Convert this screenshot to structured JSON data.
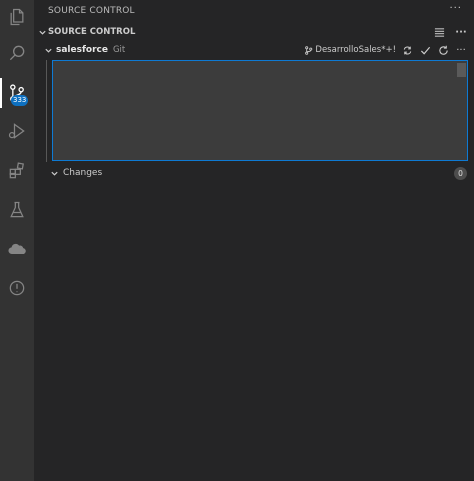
{
  "sidebar_title": "SOURCE CONTROL",
  "section": {
    "title": "SOURCE CONTROL"
  },
  "repository": {
    "name": "salesforce",
    "kind": "Git",
    "branch": "DesarrolloSales*+!"
  },
  "commit_message": {
    "value": "",
    "placeholder": ""
  },
  "changes": {
    "label": "Changes",
    "count": "0"
  },
  "activity_bar": {
    "source_control_badge": "333",
    "items": [
      "explorer-icon",
      "search-icon",
      "source-control-icon",
      "run-debug-icon",
      "extensions-icon",
      "testing-icon",
      "salesforce-cloud-icon",
      "problems-icon"
    ]
  },
  "colors": {
    "activity_bar_bg": "#333333",
    "side_bar_bg": "#252526",
    "input_bg": "#3c3c3c",
    "focus_border": "#0e7ad3",
    "badge_bg": "#0e70c0"
  }
}
